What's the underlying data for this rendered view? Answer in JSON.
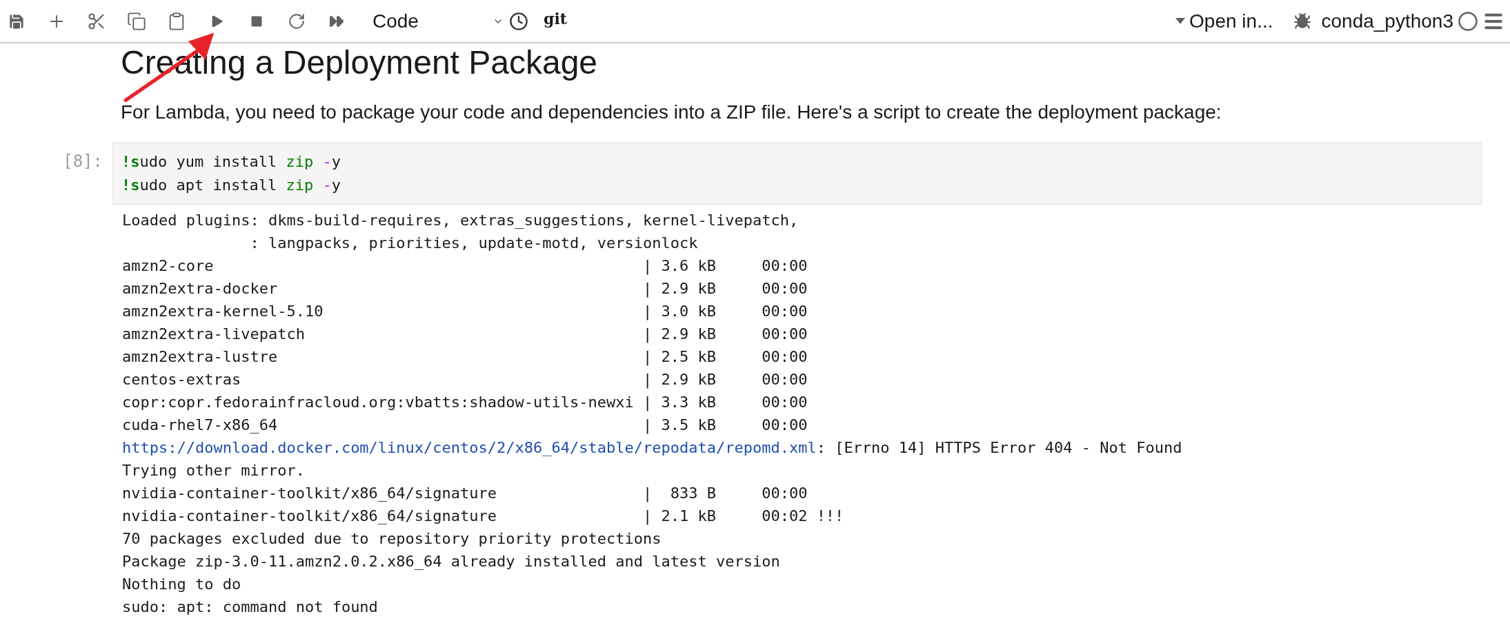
{
  "toolbar": {
    "cell_type": "Code",
    "git_label": "git",
    "open_in": "Open in...",
    "kernel_name": "conda_python3"
  },
  "notebook": {
    "heading": "Creating a Deployment Package",
    "paragraph": "For Lambda, you need to package your code and dependencies into a ZIP file. Here's a script to create the deployment package:",
    "cells": [
      {
        "prompt": "[8]:",
        "code_lines": [
          [
            {
              "kind": "bang",
              "text": "!s"
            },
            {
              "kind": "plain",
              "text": "udo yum install "
            },
            {
              "kind": "name",
              "text": "zip"
            },
            {
              "kind": "operator",
              "text": " -"
            },
            {
              "kind": "plain",
              "text": "y"
            }
          ],
          [
            {
              "kind": "bang",
              "text": "!s"
            },
            {
              "kind": "plain",
              "text": "udo apt install "
            },
            {
              "kind": "name",
              "text": "zip"
            },
            {
              "kind": "operator",
              "text": " -"
            },
            {
              "kind": "plain",
              "text": "y"
            }
          ]
        ],
        "output_lines": [
          {
            "kind": "text",
            "text": "Loaded plugins: dkms-build-requires, extras_suggestions, kernel-livepatch,"
          },
          {
            "kind": "continuation",
            "text": ": langpacks, priorities, update-motd, versionlock"
          },
          {
            "kind": "row",
            "name": "amzn2-core",
            "stats": "| 3.6 kB     00:00"
          },
          {
            "kind": "row",
            "name": "amzn2extra-docker",
            "stats": "| 2.9 kB     00:00"
          },
          {
            "kind": "row",
            "name": "amzn2extra-kernel-5.10",
            "stats": "| 3.0 kB     00:00"
          },
          {
            "kind": "row",
            "name": "amzn2extra-livepatch",
            "stats": "| 2.9 kB     00:00"
          },
          {
            "kind": "row",
            "name": "amzn2extra-lustre",
            "stats": "| 2.5 kB     00:00"
          },
          {
            "kind": "row",
            "name": "centos-extras",
            "stats": "| 2.9 kB     00:00"
          },
          {
            "kind": "row",
            "name": "copr:copr.fedorainfracloud.org:vbatts:shadow-utils-newxi",
            "stats": "| 3.3 kB     00:00"
          },
          {
            "kind": "row",
            "name": "cuda-rhel7-x86_64",
            "stats": "| 3.5 kB     00:00"
          },
          {
            "kind": "link",
            "url": "https://download.docker.com/linux/centos/2/x86_64/stable/repodata/repomd.xml",
            "text": ": [Errno 14] HTTPS Error 404 - Not Found"
          },
          {
            "kind": "text",
            "text": "Trying other mirror."
          },
          {
            "kind": "row",
            "name": "nvidia-container-toolkit/x86_64/signature",
            "stats": "|  833 B     00:00"
          },
          {
            "kind": "row",
            "name": "nvidia-container-toolkit/x86_64/signature",
            "stats": "| 2.1 kB     00:02 !!!"
          },
          {
            "kind": "text",
            "text": "70 packages excluded due to repository priority protections"
          },
          {
            "kind": "text",
            "text": "Package zip-3.0-11.amzn2.0.2.x86_64 already installed and latest version"
          },
          {
            "kind": "text",
            "text": "Nothing to do"
          },
          {
            "kind": "text",
            "text": "sudo: apt: command not found"
          }
        ]
      }
    ]
  }
}
